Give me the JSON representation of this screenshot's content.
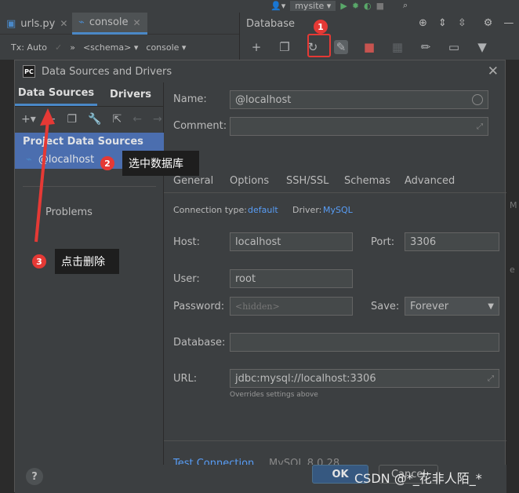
{
  "ide": {
    "tabs": [
      {
        "label": "urls.py"
      },
      {
        "label": "console"
      }
    ],
    "toolbar": {
      "tx_label": "Tx: Auto",
      "schema_label": "<schema>",
      "console_label": "console"
    },
    "run_config": "mysite",
    "db_panel_title": "Database"
  },
  "dialog": {
    "title": "Data Sources and Drivers",
    "left_tabs": [
      "Data Sources",
      "Drivers"
    ],
    "group_header": "Project Data Sources",
    "selected_source": "@localhost",
    "problems_label": "Problems",
    "name_label": "Name:",
    "name_value": "@localhost",
    "comment_label": "Comment:",
    "tabs": [
      "General",
      "Options",
      "SSH/SSL",
      "Schemas",
      "Advanced"
    ],
    "connection_type_label": "Connection type:",
    "connection_type_value": "default",
    "driver_label": "Driver:",
    "driver_value": "MySQL",
    "host_label": "Host:",
    "host_value": "localhost",
    "port_label": "Port:",
    "port_value": "3306",
    "user_label": "User:",
    "user_value": "root",
    "password_label": "Password:",
    "password_placeholder": "<hidden>",
    "save_label": "Save:",
    "save_value": "Forever",
    "database_label": "Database:",
    "url_label": "URL:",
    "url_value": "jdbc:mysql://localhost:3306",
    "url_hint": "Overrides settings above",
    "test_connection": "Test Connection",
    "driver_version": "MySQL 8.0.28",
    "ok_label": "OK",
    "cancel_label": "Cancel"
  },
  "annotations": {
    "badge1": "1",
    "badge2": "2",
    "callout2": "选中数据库",
    "badge3": "3",
    "callout3": "点击删除"
  },
  "watermark": "CSDN @*_花非人陌_*"
}
